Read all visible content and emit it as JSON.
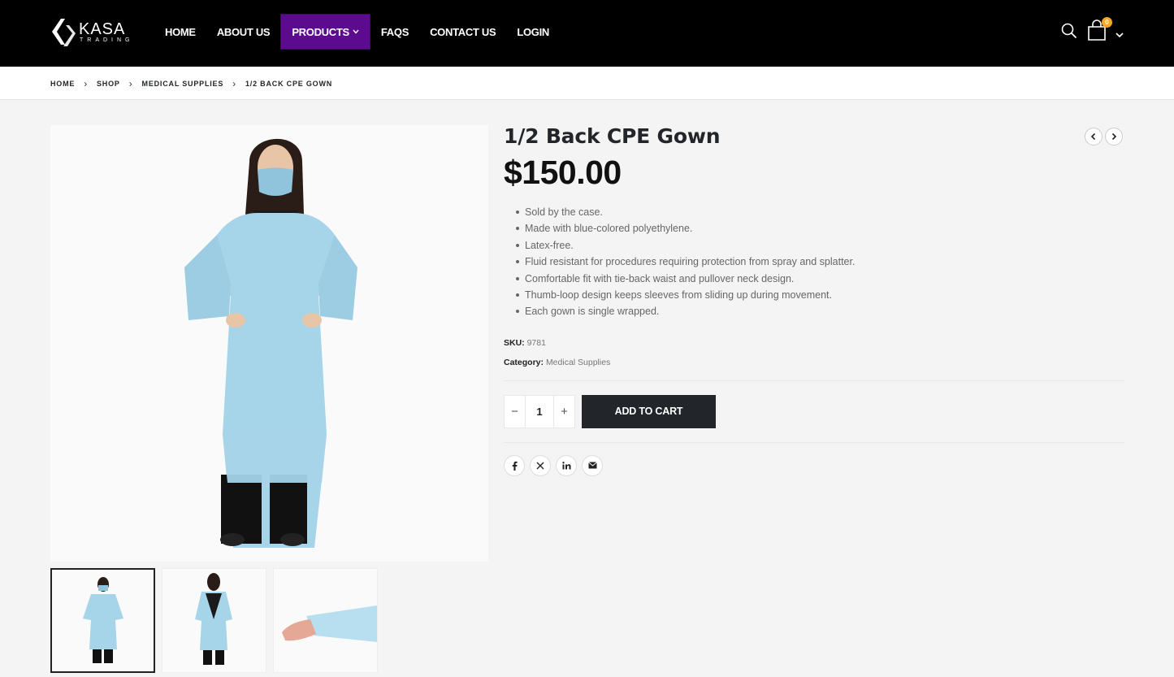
{
  "logo": {
    "main": "KASA",
    "sub": "TRADING"
  },
  "nav": {
    "items": [
      {
        "label": "HOME"
      },
      {
        "label": "ABOUT US"
      },
      {
        "label": "PRODUCTS"
      },
      {
        "label": "FAQS"
      },
      {
        "label": "CONTACT US"
      },
      {
        "label": "LOGIN"
      }
    ]
  },
  "header": {
    "cart_count": "0"
  },
  "breadcrumb": [
    "HOME",
    "SHOP",
    "MEDICAL SUPPLIES",
    "1/2 BACK CPE GOWN"
  ],
  "product": {
    "title": "1/2 Back CPE Gown",
    "price": "$150.00",
    "features": [
      "Sold by the case.",
      "Made with blue-colored polyethylene.",
      "Latex-free.",
      "Fluid resistant for procedures requiring protection from spray and splatter.",
      "Comfortable fit with tie-back waist and pullover neck design.",
      "Thumb-loop design keeps sleeves from sliding up during movement.",
      "Each gown is single wrapped."
    ],
    "sku_label": "SKU:",
    "sku": "9781",
    "category_label": "Category:",
    "category": "Medical Supplies",
    "quantity": "1",
    "qty_minus": "−",
    "qty_plus": "+",
    "add_to_cart": "ADD TO CART"
  },
  "colors": {
    "accent": "#5c0b8f",
    "badge": "#f5a623",
    "gown": "#a6d4e8",
    "dark": "#222529"
  }
}
